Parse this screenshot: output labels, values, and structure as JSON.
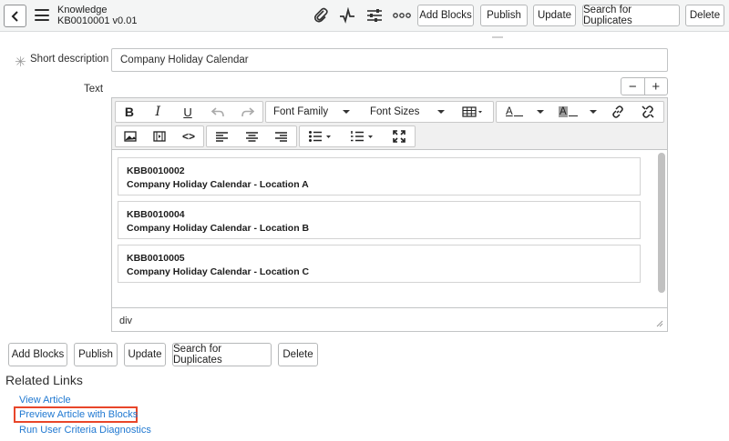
{
  "header": {
    "title": "Knowledge",
    "subtitle": "KB0010001 v0.01",
    "buttons": {
      "add_blocks": "Add Blocks",
      "publish": "Publish",
      "update": "Update",
      "search_duplicates": "Search for Duplicates",
      "delete": "Delete"
    },
    "icons": [
      "back-icon",
      "menu-icon",
      "attachment-icon",
      "activity-icon",
      "settings-sliders-icon",
      "more-icon"
    ]
  },
  "form": {
    "short_description_label": "Short description",
    "short_description_value": "Company Holiday Calendar",
    "text_label": "Text",
    "collapse_symbol": "−",
    "expand_symbol": "+"
  },
  "editor": {
    "toolbar": {
      "bold": "B",
      "italic": "I",
      "underline": "U",
      "font_family": "Font Family",
      "font_sizes": "Font Sizes",
      "text_color": "A",
      "bg_color": "A",
      "code": "<>"
    },
    "blocks": [
      {
        "number": "KBB0010002",
        "title": "Company Holiday Calendar - Location A"
      },
      {
        "number": "KBB0010004",
        "title": "Company Holiday Calendar - Location B"
      },
      {
        "number": "KBB0010005",
        "title": "Company Holiday Calendar - Location C"
      }
    ],
    "status_path": "div"
  },
  "bottom_buttons": {
    "add_blocks": "Add Blocks",
    "publish": "Publish",
    "update": "Update",
    "search_duplicates": "Search for Duplicates",
    "delete": "Delete"
  },
  "related_links": {
    "title": "Related Links",
    "links": [
      "View Article",
      "Preview Article with Blocks",
      "Run User Criteria Diagnostics"
    ]
  },
  "colors": {
    "link": "#1f78d1",
    "highlight": "#e8462a",
    "header_bg": "#f4f5f5"
  }
}
